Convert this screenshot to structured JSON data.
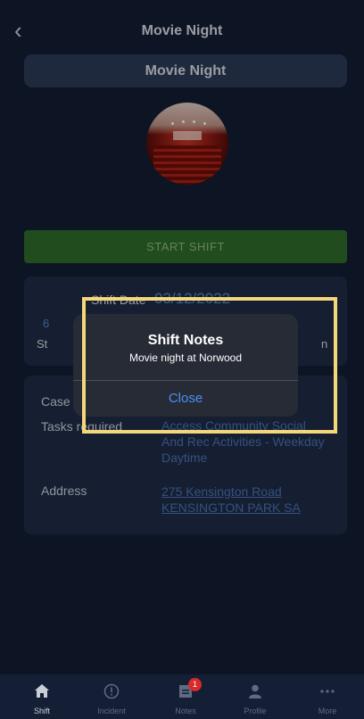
{
  "header": {
    "back_glyph": "‹",
    "title": "Movie Night"
  },
  "event": {
    "title": "Movie Night",
    "image_icon": "cinema-image"
  },
  "actions": {
    "start_shift_label": "START SHIFT"
  },
  "shift_card": {
    "date_label": "Shift Date",
    "date_value": "03/12/2022",
    "left_partial_value": "6",
    "left_partial_label": "St",
    "right_partial_label": "n"
  },
  "details": {
    "case_label": "Case",
    "tasks_label": "Tasks required",
    "tasks_value_line1": "Access Community Social",
    "tasks_value_line2": "And Rec Activities - Weekday",
    "tasks_value_line3": "Daytime",
    "address_label": "Address",
    "address_line1": "275 Kensington Road",
    "address_line2": "KENSINGTON PARK SA"
  },
  "modal": {
    "title": "Shift Notes",
    "message": "Movie night at Norwood",
    "close_label": "Close"
  },
  "tabbar": {
    "items": [
      {
        "label": "Shift",
        "icon": "home-icon"
      },
      {
        "label": "Incident",
        "icon": "alert-icon"
      },
      {
        "label": "Notes",
        "icon": "notes-icon",
        "badge": "1"
      },
      {
        "label": "Profile",
        "icon": "person-icon"
      },
      {
        "label": "More",
        "icon": "more-icon"
      }
    ]
  },
  "colors": {
    "background": "#121d33",
    "card": "#1e2b45",
    "start_button": "#2f6a2a",
    "link": "#4e8ef7",
    "highlight": "#f4d77a",
    "badge": "#d82a2a"
  }
}
